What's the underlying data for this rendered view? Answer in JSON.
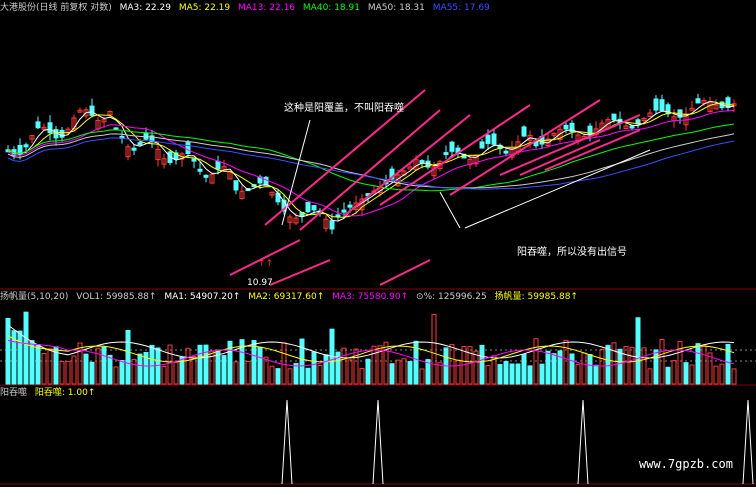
{
  "header": {
    "title": "大港股份(日线 前复权 对数)",
    "ma_items": [
      {
        "label": "MA3: 22.29",
        "color": "#ffffff"
      },
      {
        "label": "MA5: 22.19",
        "color": "#ffff00"
      },
      {
        "label": "MA13: 22.16",
        "color": "#ff00ff"
      },
      {
        "label": "MA40: 18.91",
        "color": "#00ff00"
      },
      {
        "label": "MA50: 18.31",
        "color": "#cccccc"
      },
      {
        "label": "MA55: 17.69",
        "color": "#3a4fff"
      }
    ]
  },
  "price_panel": {
    "annotation_top": "这种是阳覆盖，不叫阳吞噬",
    "annotation_bottom": "阳吞噬，所以没有出信号",
    "low_label": "10.97",
    "marker": "↑↑",
    "colors": {
      "up": "#ff3a3a",
      "down": "#54ffff",
      "trend": "#ff2a8c"
    }
  },
  "volume_panel": {
    "items": [
      {
        "label": "扬帆量(5,10,20)",
        "color": "#cccccc"
      },
      {
        "label": "VOL1: 59985.88↑",
        "color": "#cccccc"
      },
      {
        "label": "MA1: 54907.20↑",
        "color": "#ffffff"
      },
      {
        "label": "MA2: 69317.60↑",
        "color": "#ffff00"
      },
      {
        "label": "MA3: 75580.90↑",
        "color": "#ff00ff"
      },
      {
        "label": "⊙%: 125996.25",
        "color": "#cccccc"
      },
      {
        "label": "扬帆量: 59985.88↑",
        "color": "#ffff00"
      }
    ]
  },
  "signal_panel": {
    "items": [
      {
        "label": "阳吞噬",
        "color": "#cccccc"
      },
      {
        "label": "阳吞噬: 1.00↑",
        "color": "#ffff00"
      }
    ]
  },
  "watermark": "www.7gpzb.com",
  "colors": {
    "background": "#000000",
    "grid": "#880000"
  }
}
